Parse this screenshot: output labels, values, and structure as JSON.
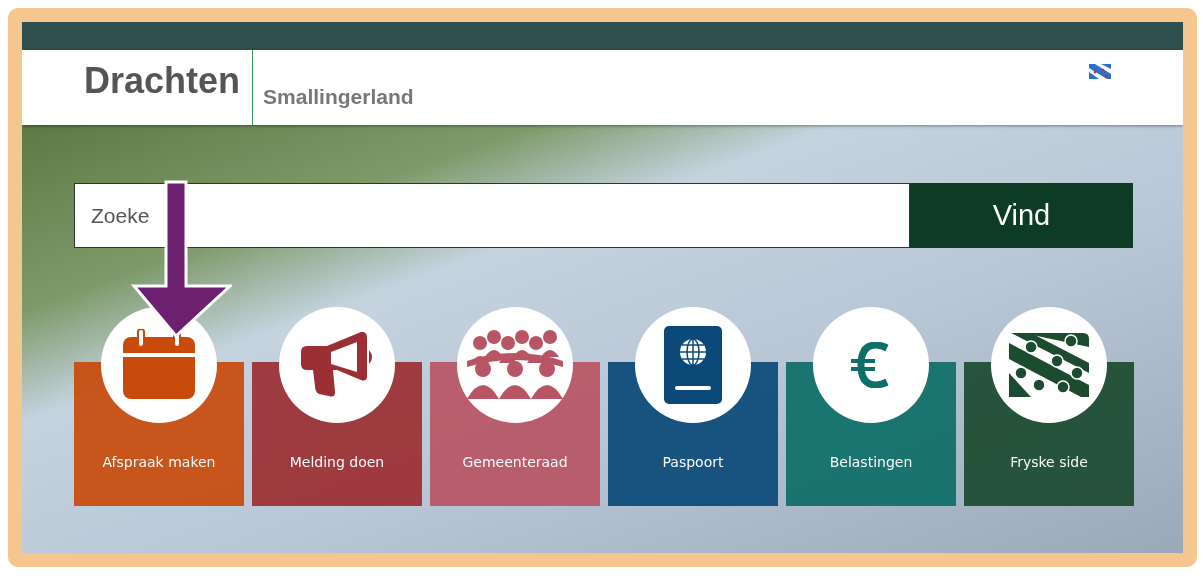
{
  "header": {
    "title": "Drachten",
    "subtitle": "Smallingerland"
  },
  "search": {
    "placeholder": "Zoeke",
    "button": "Vind"
  },
  "tiles": [
    {
      "label": "Afspraak maken",
      "kind": "calendar",
      "color": "#c84b0c"
    },
    {
      "label": "Melding doen",
      "kind": "megaphone",
      "color": "#9c2f33"
    },
    {
      "label": "Gemeenteraad",
      "kind": "council",
      "color": "#b85565"
    },
    {
      "label": "Paspoort",
      "kind": "passport",
      "color": "#0b4a78"
    },
    {
      "label": "Belastingen",
      "kind": "euro",
      "color": "#0e6e68"
    },
    {
      "label": "Fryske side",
      "kind": "flag",
      "color": "#1c4b30"
    }
  ]
}
